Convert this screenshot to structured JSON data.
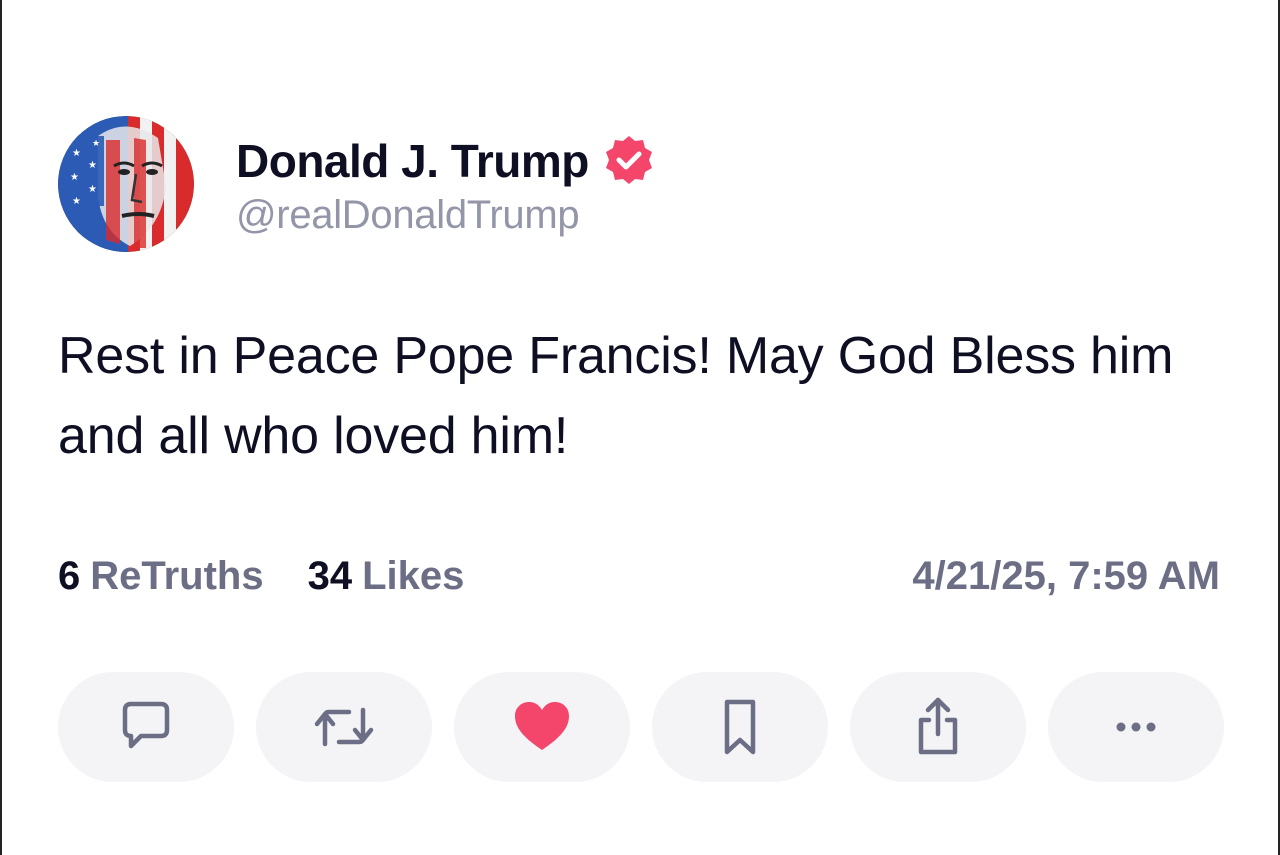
{
  "post": {
    "author": {
      "display_name": "Donald J. Trump",
      "handle": "@realDonaldTrump",
      "verified": true,
      "avatar_icon": "flag-portrait-avatar"
    },
    "body": "Rest in Peace Pope Francis! May God Bless him and all who loved him!",
    "stats": {
      "retruths_count": "6",
      "retruths_label": "ReTruths",
      "likes_count": "34",
      "likes_label": "Likes"
    },
    "timestamp": "4/21/25, 7:59 AM"
  },
  "actions": [
    {
      "icon": "comment-icon"
    },
    {
      "icon": "retruth-icon"
    },
    {
      "icon": "heart-icon",
      "active": true
    },
    {
      "icon": "bookmark-icon"
    },
    {
      "icon": "share-icon"
    },
    {
      "icon": "more-icon"
    }
  ],
  "colors": {
    "verified_badge": "#f4466b",
    "like_active": "#f4466b",
    "text_primary": "#0f0f24",
    "text_secondary": "#6b6e84",
    "button_bg": "#f4f4f7"
  }
}
